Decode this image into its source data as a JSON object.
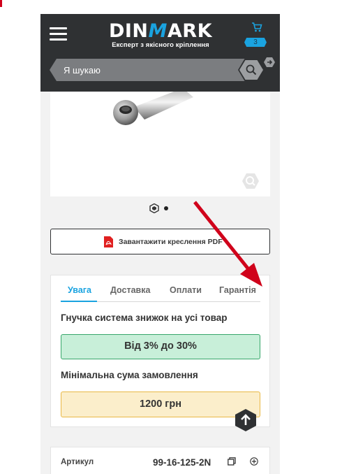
{
  "header": {
    "logo_main_left": "DIN",
    "logo_main_accent": "M",
    "logo_main_right": "ARK",
    "logo_subtitle": "Експерт з якісного кріплення",
    "cart_count": "3"
  },
  "search": {
    "placeholder": "Я шукаю"
  },
  "gallery": {
    "slides": 2,
    "active_slide": 1
  },
  "pdf_button": {
    "label": "Завантажити креслення PDF"
  },
  "info_tabs": [
    {
      "label": "Увага",
      "active": true
    },
    {
      "label": "Доставка",
      "active": false
    },
    {
      "label": "Оплати",
      "active": false
    },
    {
      "label": "Гарантія",
      "active": false
    }
  ],
  "notice": {
    "discount_heading": "Гнучка система знижок на усі товар",
    "discount_value": "Від 3% до 30%",
    "min_order_heading": "Мінімальна сума замовлення",
    "min_order_value": "1200 грн"
  },
  "details": {
    "sku_label": "Артикул",
    "sku_value": "99-16-125-2N"
  },
  "colors": {
    "header_bg": "#2f3133",
    "accent": "#1aa3e0",
    "discount_bg": "#c8efd9",
    "discount_border": "#37a66a",
    "min_bg": "#fbeecb",
    "min_border": "#e9b845",
    "annotation_arrow": "#d0021b"
  }
}
